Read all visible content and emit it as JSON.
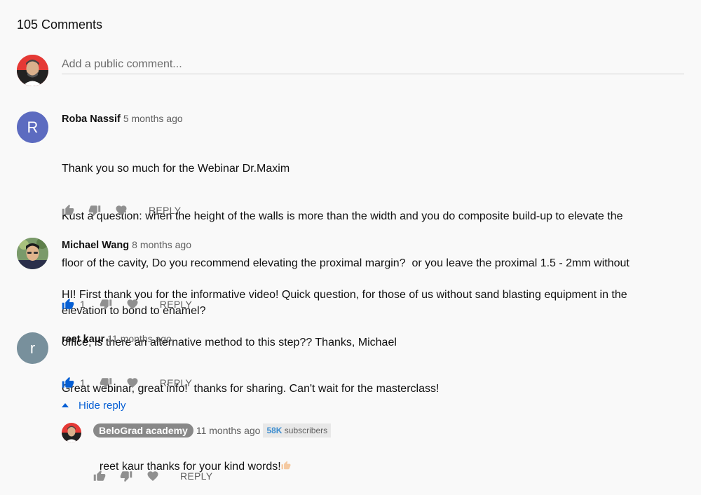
{
  "comments_header": {
    "count_label": "105 Comments"
  },
  "composer": {
    "placeholder": "Add a public comment..."
  },
  "comments": [
    {
      "author": "Roba Nassif",
      "time": "5 months ago",
      "avatar_letter": "R",
      "avatar_color": "#5c6bc0",
      "lines": [
        "Thank you so much for the Webinar Dr.Maxim",
        "Kust a question: when the height of the walls is more than the width and you do composite build-up to elevate the",
        "floor of the cavity, Do you recommend elevating the proximal margin?  or you leave the proximal 1.5 - 2mm without",
        "elevation to bond to enamel?"
      ],
      "likes": "",
      "reply_label": "REPLY"
    },
    {
      "author": "Michael Wang",
      "time": "8 months ago",
      "lines": [
        "HI! First thank you for the informative video! Quick question, for those of us without sand blasting equipment in the",
        "office, is there an alternative method to this step?? Thanks, Michael"
      ],
      "likes": "1",
      "reply_label": "REPLY"
    },
    {
      "author": "reet kaur",
      "time": "11 months ago",
      "avatar_letter": "r",
      "avatar_color": "#78909c",
      "lines": [
        "Great webinar, great info!  thanks for sharing. Can't wait for the masterclass!"
      ],
      "likes": "1",
      "reply_label": "REPLY",
      "hide_reply_label": "Hide reply",
      "reply": {
        "author": "BeloGrad academy",
        "time": "11 months ago",
        "subscribers_num": "58K",
        "subscribers_label": " subscribers",
        "text": "reet kaur thanks for your kind words!",
        "reply_label": "REPLY"
      }
    }
  ],
  "colors": {
    "accent_blue": "#065fd4",
    "icon_gray": "#909090"
  }
}
